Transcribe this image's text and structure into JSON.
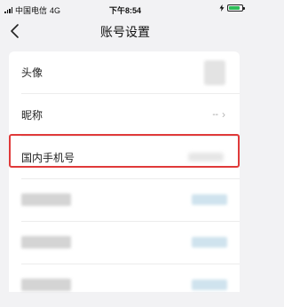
{
  "status_bar": {
    "carrier": "中国电信",
    "network": "4G",
    "time": "下午8:54",
    "battery_level": 0.85
  },
  "nav": {
    "back_icon": "chevron-left-icon",
    "title": "账号设置"
  },
  "settings": {
    "avatar_label": "头像",
    "nickname_label": "昵称",
    "nickname_value": "--",
    "nickname_chevron": "›",
    "phone_label": "国内手机号"
  },
  "colors": {
    "highlight_border": "#e03a3a",
    "battery_fill": "#2ebd59"
  }
}
